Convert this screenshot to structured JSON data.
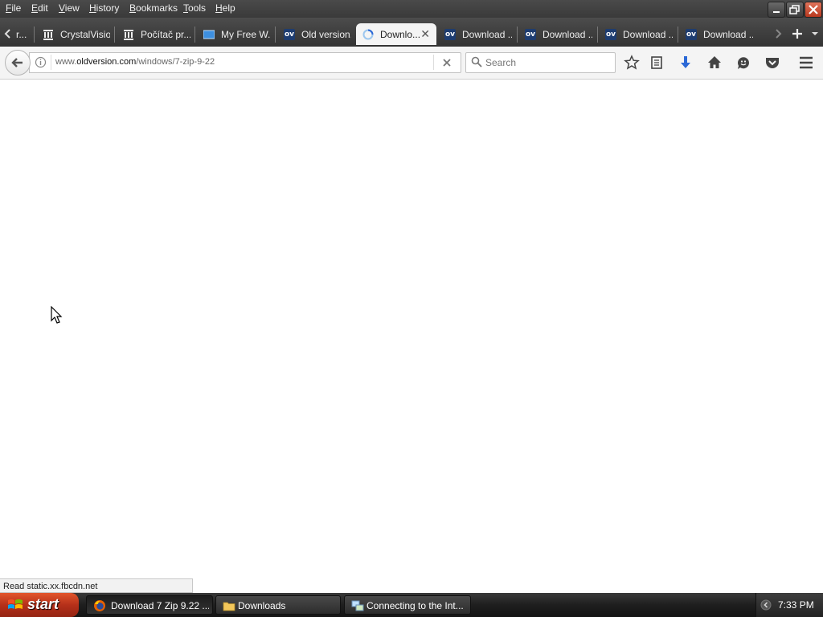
{
  "menu": {
    "items": [
      "File",
      "Edit",
      "View",
      "History",
      "Bookmarks",
      "Tools",
      "Help"
    ]
  },
  "tabs": [
    {
      "label": "r...",
      "icon": "page-icon"
    },
    {
      "label": "CrystalVisio...",
      "icon": "building-icon"
    },
    {
      "label": "Počítač pr...",
      "icon": "building-icon"
    },
    {
      "label": "My Free W...",
      "icon": "monitor-icon"
    },
    {
      "label": "Old version...",
      "icon": "ov-icon"
    },
    {
      "label": "Downlo...",
      "icon": "loading-spinner-icon",
      "active": true
    },
    {
      "label": "Download ...",
      "icon": "ov-icon"
    },
    {
      "label": "Download ...",
      "icon": "ov-icon"
    },
    {
      "label": "Download ...",
      "icon": "ov-icon"
    },
    {
      "label": "Download ...",
      "icon": "ov-icon"
    }
  ],
  "ov_badge": "ov",
  "navbar": {
    "url_prefix": "www.",
    "url_host": "oldversion.com",
    "url_path": "/windows/7-zip-9-22",
    "search_placeholder": "Search"
  },
  "status_text": "Read static.xx.fbcdn.net",
  "taskbar": {
    "start_label": "start",
    "tasks": [
      {
        "label": "Download 7 Zip 9.22 ...",
        "icon": "firefox-icon",
        "active": true
      },
      {
        "label": "Downloads",
        "icon": "folder-icon"
      },
      {
        "label": "Connecting to the Int...",
        "icon": "network-icon"
      }
    ],
    "clock": "7:33 PM"
  },
  "colors": {
    "toolbar_bg": "#f4f4f4",
    "download_arrow": "#2b68d6",
    "start_button": "#c13e20",
    "ov_badge": "#1d3c70"
  }
}
